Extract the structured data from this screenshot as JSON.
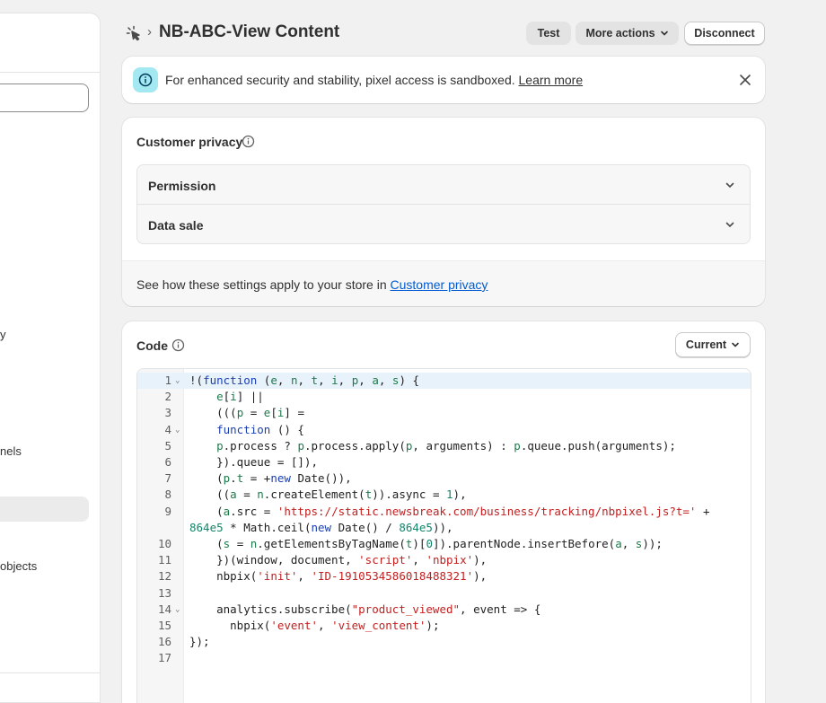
{
  "sidebar": {
    "fragments": [
      "y",
      "nels",
      "objects"
    ]
  },
  "header": {
    "breadcrumb_icon": "pixel-icon",
    "separator": "›",
    "title": "NB-ABC-View Content",
    "buttons": {
      "test": "Test",
      "more_actions": "More actions",
      "disconnect": "Disconnect"
    }
  },
  "banner": {
    "message": "For enhanced security and stability, pixel access is sandboxed.",
    "link": "Learn more",
    "accent": "#a4e8f2"
  },
  "privacy": {
    "title": "Customer privacy",
    "items": [
      "Permission",
      "Data sale"
    ],
    "footer_text": "See how these settings apply to your store in",
    "footer_link": "Customer privacy",
    "link_color": "#005bd3"
  },
  "code": {
    "title": "Code",
    "version_select": "Current",
    "lines": [
      {
        "n": "1",
        "fold": true,
        "text": "!(function (e, n, t, i, p, a, s) {"
      },
      {
        "n": "2",
        "fold": false,
        "text": "    e[i] ||"
      },
      {
        "n": "3",
        "fold": false,
        "text": "    (((p = e[i] ="
      },
      {
        "n": "4",
        "fold": true,
        "text": "    function () {"
      },
      {
        "n": "5",
        "fold": false,
        "text": "    p.process ? p.process.apply(p, arguments) : p.queue.push(arguments);"
      },
      {
        "n": "6",
        "fold": false,
        "text": "    }).queue = []),"
      },
      {
        "n": "7",
        "fold": false,
        "text": "    (p.t = +new Date()),"
      },
      {
        "n": "8",
        "fold": false,
        "text": "    ((a = n.createElement(t)).async = 1),"
      },
      {
        "n": "9",
        "fold": false,
        "text": "    (a.src = 'https://static.newsbreak.com/business/tracking/nbpixel.js?t=' +"
      },
      {
        "n": "",
        "fold": false,
        "text": "864e5 * Math.ceil(new Date() / 864e5)),"
      },
      {
        "n": "10",
        "fold": false,
        "text": "    (s = n.getElementsByTagName(t)[0]).parentNode.insertBefore(a, s));"
      },
      {
        "n": "11",
        "fold": false,
        "text": "    })(window, document, 'script', 'nbpix'),"
      },
      {
        "n": "12",
        "fold": false,
        "text": "    nbpix('init', 'ID-1910534586018488321'),"
      },
      {
        "n": "13",
        "fold": false,
        "text": ""
      },
      {
        "n": "14",
        "fold": true,
        "text": "    analytics.subscribe(\"product_viewed\", event => {"
      },
      {
        "n": "15",
        "fold": false,
        "text": "      nbpix('event', 'view_content');"
      },
      {
        "n": "16",
        "fold": false,
        "text": "});"
      },
      {
        "n": "17",
        "fold": false,
        "text": ""
      }
    ]
  }
}
